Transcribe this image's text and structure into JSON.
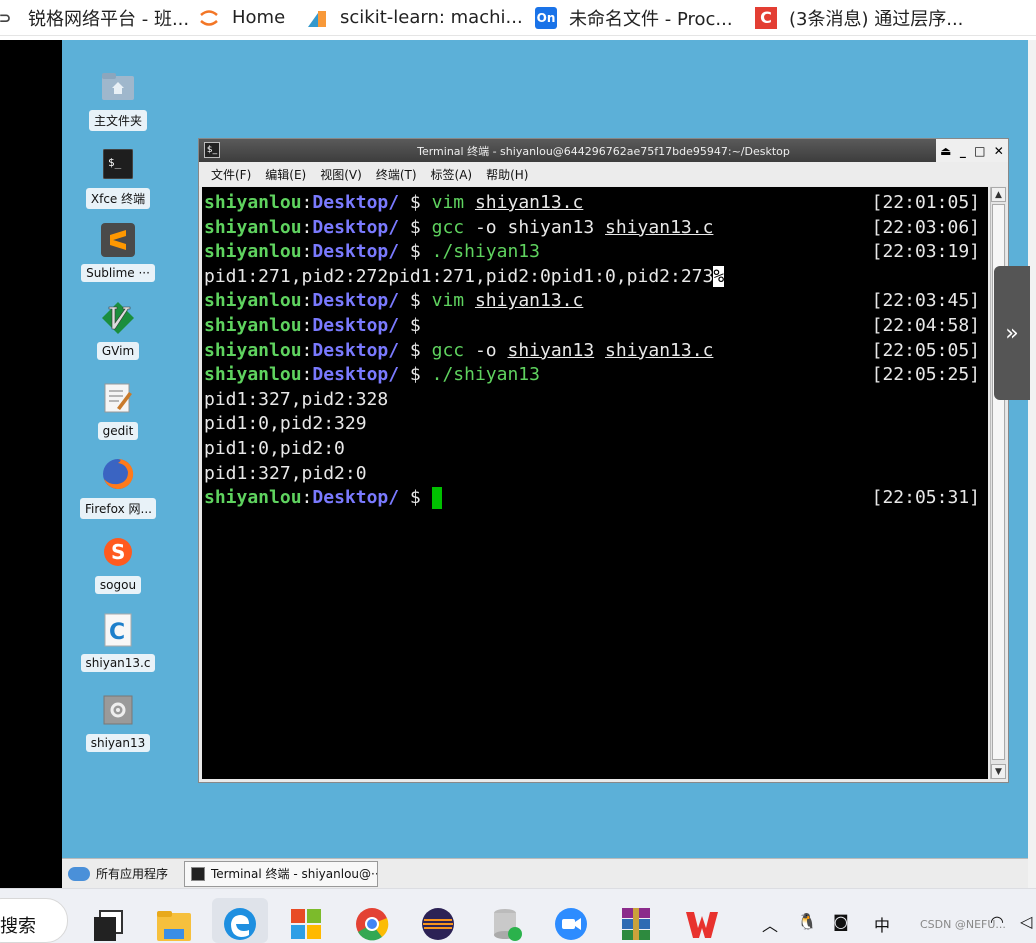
{
  "bookmarks": [
    {
      "label": "锐格网络平台 - 班...",
      "icon": "ruige-icon",
      "color": "#444444"
    },
    {
      "label": "Home",
      "icon": "jupyter-icon",
      "color": "#f37626"
    },
    {
      "label": "scikit-learn: machi...",
      "icon": "sklearn-icon",
      "color": "#f89939"
    },
    {
      "label": "未命名文件 - Proc...",
      "icon": "processon-icon",
      "color": "#1a73e8"
    },
    {
      "label": "(3条消息) 通过层序...",
      "icon": "csdn-icon",
      "color": "#e33e33"
    }
  ],
  "desktop_icons": [
    {
      "label": "主文件夹",
      "icon": "home-folder-icon"
    },
    {
      "label": "Xfce 终端",
      "icon": "terminal-icon"
    },
    {
      "label": "Sublime ···",
      "icon": "sublime-icon"
    },
    {
      "label": "GVim",
      "icon": "vim-icon"
    },
    {
      "label": "gedit",
      "icon": "gedit-icon"
    },
    {
      "label": "Firefox 网...",
      "icon": "firefox-icon"
    },
    {
      "label": "sogou",
      "icon": "sogou-icon"
    },
    {
      "label": "shiyan13.c",
      "icon": "c-file-icon"
    },
    {
      "label": "shiyan13",
      "icon": "executable-icon"
    }
  ],
  "terminal": {
    "title": "Terminal 终端 - shiyanlou@644296762ae75f17bde95947:~/Desktop",
    "menu": [
      "文件(F)",
      "编辑(E)",
      "视图(V)",
      "终端(T)",
      "标签(A)",
      "帮助(H)"
    ],
    "user": "shiyanlou",
    "path": "Desktop/",
    "prompt_symbol": "$",
    "lines": [
      {
        "kind": "prompt",
        "cmd": "vim",
        "args": " shiyan13.c",
        "time": "[22:01:05]"
      },
      {
        "kind": "prompt",
        "cmd": "gcc",
        "args": " -o shiyan13 shiyan13.c",
        "time": "[22:03:06]"
      },
      {
        "kind": "prompt",
        "cmd": "./shiyan13",
        "args": "",
        "time": "[22:03:19]"
      },
      {
        "kind": "output",
        "text": "pid1:271,pid2:272pid1:271,pid2:0pid1:0,pid2:273",
        "mark": "%"
      },
      {
        "kind": "prompt",
        "cmd": "vim",
        "args": " shiyan13.c",
        "time": "[22:03:45]"
      },
      {
        "kind": "prompt",
        "cmd": "",
        "args": "",
        "time": "[22:04:58]"
      },
      {
        "kind": "prompt",
        "cmd": "gcc",
        "args": " -o shiyan13 shiyan13.c",
        "time": "[22:05:05]"
      },
      {
        "kind": "prompt",
        "cmd": "./shiyan13",
        "args": "",
        "time": "[22:05:25]"
      },
      {
        "kind": "output",
        "text": "pid1:327,pid2:328"
      },
      {
        "kind": "output",
        "text": "pid1:0,pid2:329"
      },
      {
        "kind": "output",
        "text": "pid1:0,pid2:0"
      },
      {
        "kind": "output",
        "text": "pid1:327,pid2:0"
      },
      {
        "kind": "prompt",
        "cmd": "",
        "args": "",
        "time": "[22:05:31]",
        "cursor": true
      }
    ]
  },
  "side_button": "»",
  "xfce_panel": {
    "apps_label": "所有应用程序",
    "task_label": "Terminal 终端 - shiyanlou@···"
  },
  "windows_taskbar": {
    "search_label": "搜索",
    "tray_ime": "中",
    "tray_watermark": "CSDN @NEFU..."
  }
}
